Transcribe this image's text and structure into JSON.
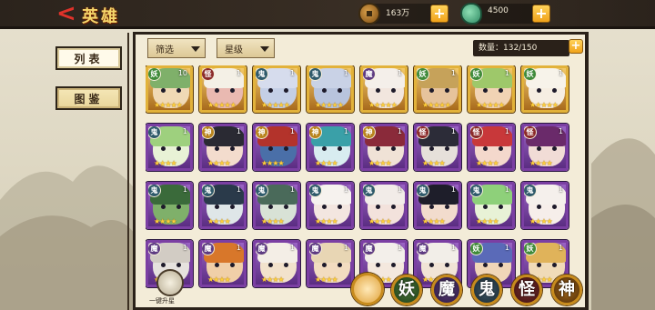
{
  "header": {
    "back_symbol": "<",
    "title": "英雄",
    "coins": {
      "icon": "coin-icon",
      "value": "163万",
      "plus": "+"
    },
    "jade": {
      "icon": "jade-icon",
      "value": "4500",
      "plus": "+"
    }
  },
  "sidebar": {
    "items": [
      {
        "label": "列表",
        "active": true
      },
      {
        "label": "图鉴",
        "active": false
      }
    ]
  },
  "toolbar": {
    "filter_label": "筛选",
    "star_label": "星级",
    "count_label": "数量：132/150",
    "count_plus": "+"
  },
  "heroes": [
    {
      "type": "妖",
      "level": "10",
      "stars": 5,
      "frame": "gold",
      "skin": "#f0d9b5",
      "hair": "#7fb06a"
    },
    {
      "type": "怪",
      "level": "1",
      "stars": 5,
      "frame": "gold",
      "skin": "#e9b9b1",
      "hair": "#f4f0e6"
    },
    {
      "type": "鬼",
      "level": "1",
      "stars": 5,
      "frame": "gold",
      "skin": "#c4cfe6",
      "hair": "#d6dced"
    },
    {
      "type": "鬼",
      "level": "1",
      "stars": 5,
      "frame": "gold",
      "skin": "#b8c4dd",
      "hair": "#c9d2e6"
    },
    {
      "type": "魔",
      "level": "1",
      "stars": 5,
      "frame": "gold",
      "skin": "#f2e6de",
      "hair": "#f4efea"
    },
    {
      "type": "妖",
      "level": "1",
      "stars": 5,
      "frame": "gold",
      "skin": "#e6c39c",
      "hair": "#c6a25a"
    },
    {
      "type": "妖",
      "level": "1",
      "stars": 5,
      "frame": "gold",
      "skin": "#f1d3b4",
      "hair": "#9ec86a"
    },
    {
      "type": "妖",
      "level": "1",
      "stars": 5,
      "frame": "gold",
      "skin": "#f6eee2",
      "hair": "#f7f3ea"
    },
    {
      "type": "鬼",
      "level": "1",
      "stars": 4,
      "frame": "purple",
      "skin": "#e8f2d6",
      "hair": "#9ed07e"
    },
    {
      "type": "神",
      "level": "1",
      "stars": 4,
      "frame": "purple",
      "skin": "#f3dccd",
      "hair": "#2a2a33"
    },
    {
      "type": "神",
      "level": "1",
      "stars": 4,
      "frame": "purple",
      "skin": "#4a6fa8",
      "hair": "#b3332b"
    },
    {
      "type": "神",
      "level": "1",
      "stars": 4,
      "frame": "purple",
      "skin": "#d8ecf0",
      "hair": "#3aa0a8"
    },
    {
      "type": "神",
      "level": "1",
      "stars": 4,
      "frame": "purple",
      "skin": "#f0e2d6",
      "hair": "#8a2a3a"
    },
    {
      "type": "怪",
      "level": "1",
      "stars": 4,
      "frame": "purple",
      "skin": "#e6e0da",
      "hair": "#2c2c38"
    },
    {
      "type": "怪",
      "level": "1",
      "stars": 4,
      "frame": "purple",
      "skin": "#f4d8cc",
      "hair": "#c8383a"
    },
    {
      "type": "怪",
      "level": "1",
      "stars": 4,
      "frame": "purple",
      "skin": "#f1dcd6",
      "hair": "#6a2a6a"
    },
    {
      "type": "鬼",
      "level": "1",
      "stars": 4,
      "frame": "purple",
      "skin": "#7fb06a",
      "hair": "#3a6a3a"
    },
    {
      "type": "鬼",
      "level": "1",
      "stars": 4,
      "frame": "purple",
      "skin": "#dfe6e8",
      "hair": "#2a3a4a"
    },
    {
      "type": "鬼",
      "level": "1",
      "stars": 4,
      "frame": "purple",
      "skin": "#d8e2d6",
      "hair": "#4a6a5a"
    },
    {
      "type": "鬼",
      "level": "1",
      "stars": 4,
      "frame": "purple",
      "skin": "#f3e6e0",
      "hair": "#f6f2ee"
    },
    {
      "type": "鬼",
      "level": "1",
      "stars": 4,
      "frame": "purple",
      "skin": "#f3e2dc",
      "hair": "#f2ece8"
    },
    {
      "type": "鬼",
      "level": "1",
      "stars": 4,
      "frame": "purple",
      "skin": "#f2dccd",
      "hair": "#1e1e2a"
    },
    {
      "type": "鬼",
      "level": "1",
      "stars": 4,
      "frame": "purple",
      "skin": "#e8f2d6",
      "hair": "#8ed07a"
    },
    {
      "type": "鬼",
      "level": "1",
      "stars": 4,
      "frame": "purple",
      "skin": "#f6eeea",
      "hair": "#f5f0ec"
    },
    {
      "type": "魔",
      "level": "1",
      "stars": 4,
      "frame": "purple",
      "skin": "#e6e2de",
      "hair": "#d2ccc4"
    },
    {
      "type": "魔",
      "level": "1",
      "stars": 4,
      "frame": "purple",
      "skin": "#f0cfa8",
      "hair": "#d8772a"
    },
    {
      "type": "魔",
      "level": "1",
      "stars": 4,
      "frame": "purple",
      "skin": "#f2e2cc",
      "hair": "#f4eee6"
    },
    {
      "type": "魔",
      "level": "1",
      "stars": 4,
      "frame": "purple",
      "skin": "#f2dcc0",
      "hair": "#e8d6b4"
    },
    {
      "type": "魔",
      "level": "1",
      "stars": 4,
      "frame": "purple",
      "skin": "#f4e8de",
      "hair": "#f3efea"
    },
    {
      "type": "魔",
      "level": "1",
      "stars": 4,
      "frame": "purple",
      "skin": "#f1e4d6",
      "hair": "#f2eee8"
    },
    {
      "type": "妖",
      "level": "1",
      "stars": 4,
      "frame": "purple",
      "skin": "#f0d6b8",
      "hair": "#5a6ab8"
    },
    {
      "type": "妖",
      "level": "1",
      "stars": 4,
      "frame": "purple",
      "skin": "#f0dbb8",
      "hair": "#e0b35a"
    }
  ],
  "bottom": {
    "upgrade_label": "一键升星",
    "categories": [
      {
        "label": "",
        "key": "all"
      },
      {
        "label": "妖",
        "key": "yao"
      },
      {
        "label": "魔",
        "key": "mo"
      },
      {
        "label": "鬼",
        "key": "gui"
      },
      {
        "label": "怪",
        "key": "guai"
      },
      {
        "label": "神",
        "key": "shen"
      }
    ]
  },
  "colors": {
    "accent_gold": "#f0a21a",
    "frame_purple": "#7b3fa3",
    "frame_gold": "#e2b23a",
    "ink": "#2a2119"
  }
}
